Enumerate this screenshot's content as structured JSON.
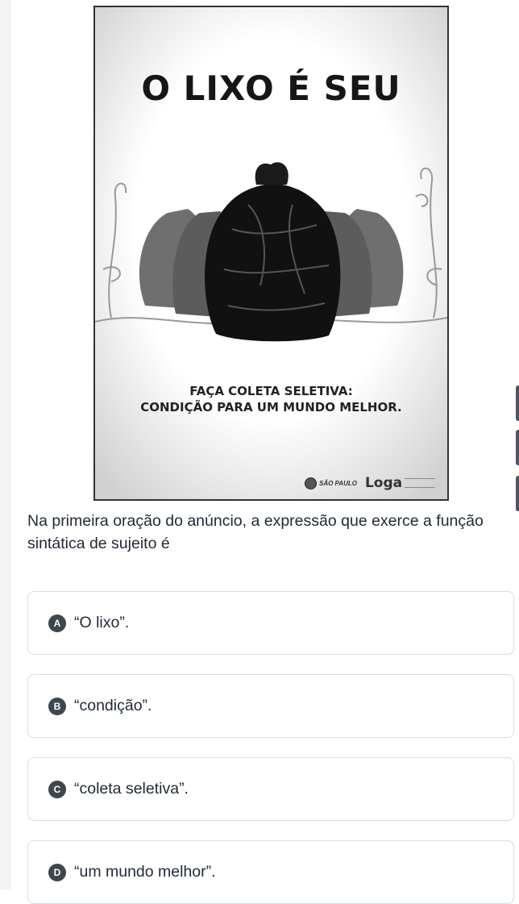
{
  "poster": {
    "headline": "O LIXO É SEU",
    "tagline_line1": "FAÇA COLETA SELETIVA:",
    "tagline_line2": "CONDIÇÃO PARA UM MUNDO MELHOR.",
    "logo_sp": "SÃO PAULO",
    "logo_loga": "Loga"
  },
  "question": {
    "text": "Na primeira oração do anúncio, a expressão que exerce a função sintática de sujeito é"
  },
  "options": [
    {
      "letter": "A",
      "text": "“O lixo”."
    },
    {
      "letter": "B",
      "text": "“condição”."
    },
    {
      "letter": "C",
      "text": "“coleta seletiva”."
    },
    {
      "letter": "D",
      "text": "“um mundo melhor”."
    }
  ]
}
